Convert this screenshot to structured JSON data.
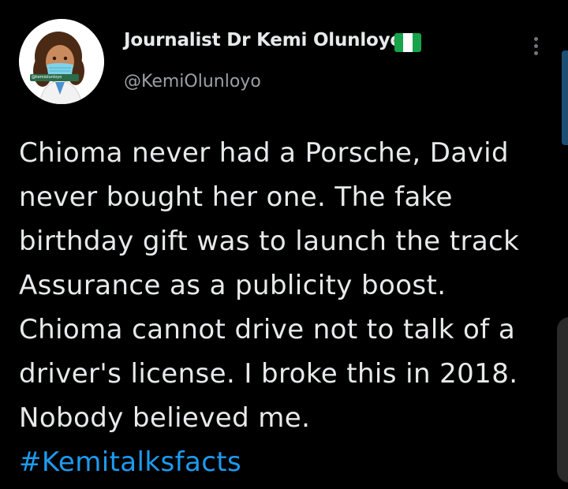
{
  "author": {
    "name": "Journalist Dr Kemi Olunloyo",
    "handle": "@KemiOlunloyo",
    "flag_icon": "nigeria-flag-emoji",
    "avatar_icon": "cartoon-avatar-with-face-mask",
    "avatar_caption": "@kemiolunloyo"
  },
  "menu": {
    "icon": "more-vertical-icon"
  },
  "tweet": {
    "lines": [
      "Chioma never had a Porsche, David",
      "never bought her one. The fake",
      "birthday gift was to launch the track",
      "Assurance as a publicity boost.",
      "Chioma cannot drive not to talk of a",
      "driver's license. I broke this in 2018.",
      "Nobody believed me."
    ],
    "hashtag": "#Kemitalksfacts"
  },
  "colors": {
    "background": "#000000",
    "text": "#e7e9ea",
    "secondary_text": "#9aa0a6",
    "link": "#1d9bf0",
    "flag_green": "#17a34a"
  }
}
